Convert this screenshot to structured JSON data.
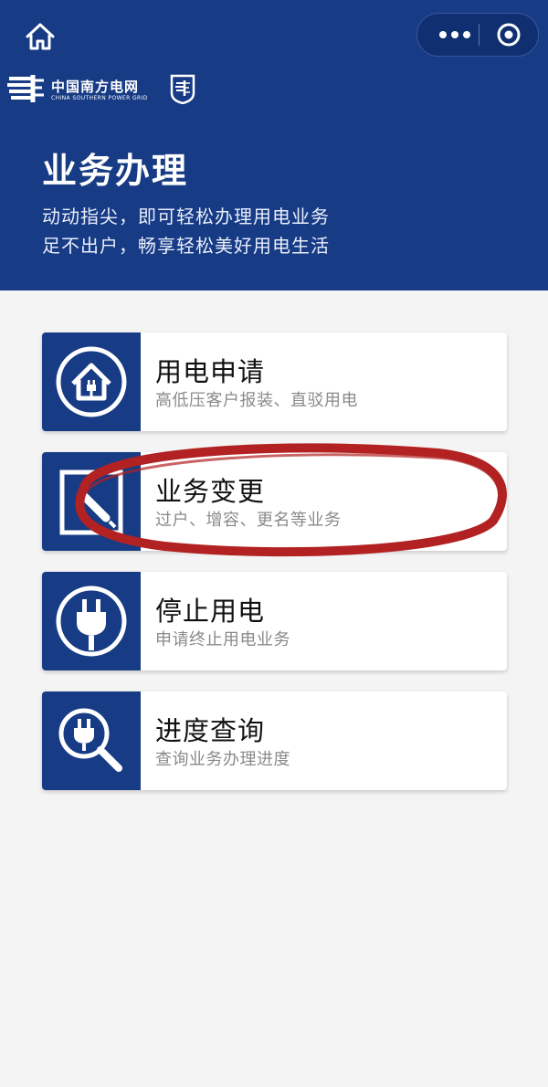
{
  "header": {
    "logo_cn": "中国南方电网",
    "logo_en": "CHINA SOUTHERN POWER GRID",
    "title": "业务办理",
    "subtitle_line1": "动动指尖，即可轻松办理用电业务",
    "subtitle_line2": "足不出户，畅享轻松美好用电生活",
    "bg_color": "#173b84"
  },
  "top_bar": {
    "home_icon": "home-icon",
    "more_icon": "more-dots-icon",
    "close_icon": "close-circle-icon"
  },
  "services": [
    {
      "title": "用电申请",
      "desc": "高低压客户报装、直驳用电",
      "icon": "house-plug-icon"
    },
    {
      "title": "业务变更",
      "desc": "过户、增容、更名等业务",
      "icon": "edit-document-icon"
    },
    {
      "title": "停止用电",
      "desc": "申请终止用电业务",
      "icon": "plug-icon"
    },
    {
      "title": "进度查询",
      "desc": "查询业务办理进度",
      "icon": "magnifier-plug-icon"
    }
  ],
  "colors": {
    "accent": "#173b84",
    "annotation": "#b22222"
  }
}
